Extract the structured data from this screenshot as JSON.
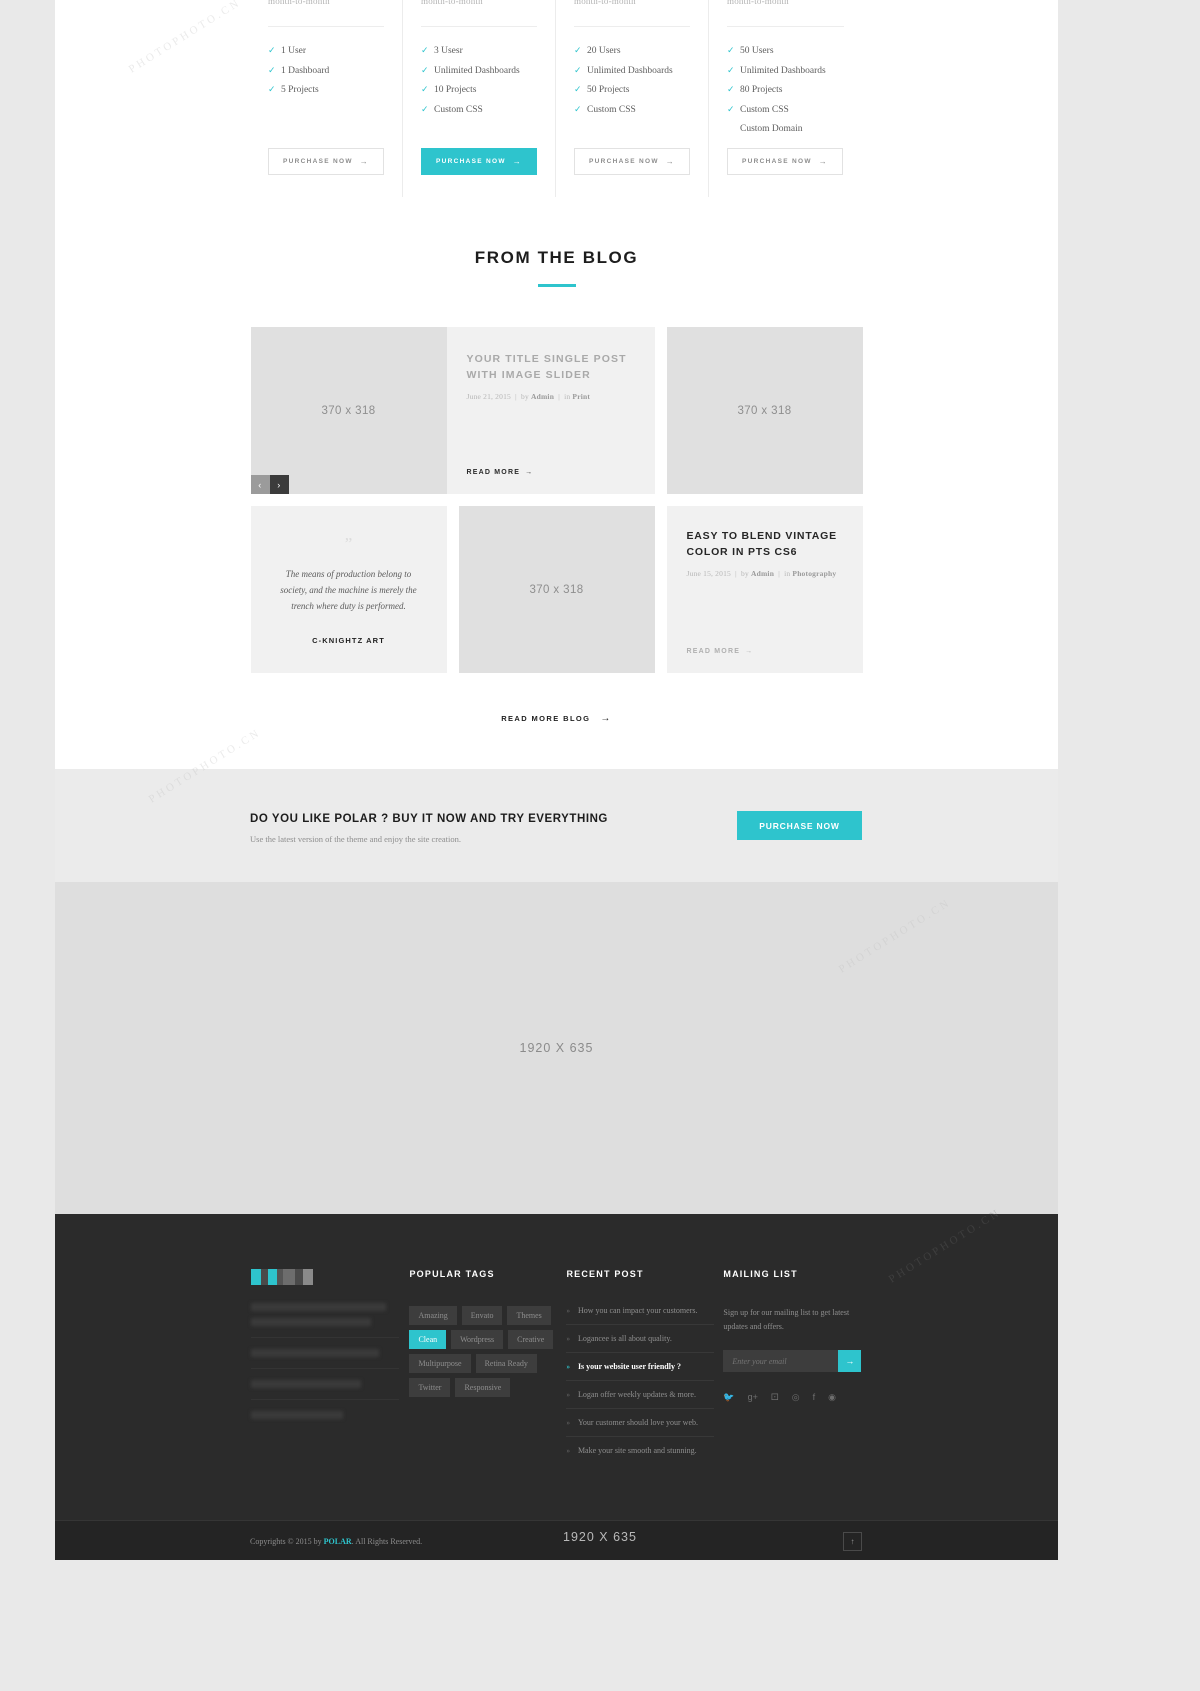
{
  "pricing": {
    "columns": [
      {
        "period": "month-to-month",
        "features": [
          "1 User",
          "1 Dashboard",
          "5 Projects"
        ],
        "button": "PURCHASE NOW",
        "featured": false
      },
      {
        "period": "month-to-month",
        "features": [
          "3 Usesr",
          "Unlimited Dashboards",
          "10 Projects",
          "Custom CSS"
        ],
        "button": "PURCHASE NOW",
        "featured": true
      },
      {
        "period": "month-to-month",
        "features": [
          "20 Users",
          "Unlimited Dashboards",
          "50 Projects",
          "Custom CSS"
        ],
        "button": "PURCHASE NOW",
        "featured": false
      },
      {
        "period": "month-to-month",
        "features": [
          "50 Users",
          "Unlimited Dashboards",
          "80 Projects",
          "Custom CSS",
          "Custom Domain"
        ],
        "button": "PURCHASE NOW",
        "featured": false
      }
    ]
  },
  "blog": {
    "section_title": "FROM THE BLOG",
    "slider_placeholder": "370 x 318",
    "slider_prev": "‹",
    "slider_next": "›",
    "post1": {
      "title": "YOUR TITLE SINGLE POST WITH IMAGE SLIDER",
      "date": "June 21, 2015",
      "by_label": "by",
      "author": "Admin",
      "in_label": "in",
      "category": "Print",
      "read_more": "READ MORE"
    },
    "quote": {
      "mark": "”",
      "text": "The means of production belong to society, and the machine is merely the trench where duty is performed.",
      "author": "C-KNIGHTZ ART"
    },
    "square_placeholder": "370 x 318",
    "right_placeholder": "370 x 318",
    "post2": {
      "title": "EASY TO BLEND VINTAGE COLOR IN PTS CS6",
      "date": "June 15, 2015",
      "by_label": "by",
      "author": "Admin",
      "in_label": "in",
      "category": "Photography",
      "read_more": "READ MORE"
    },
    "read_more_blog": "READ MORE BLOG"
  },
  "cta": {
    "title": "DO YOU LIKE POLAR ? BUY IT NOW AND TRY EVERYTHING",
    "subtitle": "Use the latest version of the theme and enjoy the site creation.",
    "button": "PURCHASE NOW"
  },
  "hero_placeholder": "1920 X 635",
  "footer": {
    "tags_heading": "POPULAR TAGS",
    "tags": [
      {
        "label": "Amazing",
        "active": false
      },
      {
        "label": "Envato",
        "active": false
      },
      {
        "label": "Themes",
        "active": false
      },
      {
        "label": "Clean",
        "active": true
      },
      {
        "label": "Wordpress",
        "active": false
      },
      {
        "label": "Creative",
        "active": false
      },
      {
        "label": "Multipurpose",
        "active": false
      },
      {
        "label": "Retina Ready",
        "active": false
      },
      {
        "label": "Twitter",
        "active": false
      },
      {
        "label": "Responsive",
        "active": false
      }
    ],
    "recent_heading": "RECENT POST",
    "recent_posts": [
      {
        "label": "How you can impact your customers.",
        "active": false
      },
      {
        "label": "Logancee is all about quality.",
        "active": false
      },
      {
        "label": "Is your website user friendly ?",
        "active": true
      },
      {
        "label": "Logan offer weekly updates & more.",
        "active": false
      },
      {
        "label": "Your customer should love your web.",
        "active": false
      },
      {
        "label": "Make your site smooth and stunning.",
        "active": false
      }
    ],
    "mailing_heading": "MAILING LIST",
    "mailing_text": "Sign up for our mailing list to get latest updates and offers.",
    "mail_placeholder": "Enter your email",
    "mail_submit": "→",
    "socials": [
      "twitter-icon",
      "google-plus-icon",
      "pinterest-icon",
      "rss-icon",
      "facebook-icon",
      "dribbble-icon"
    ],
    "copyright_prefix": "Copyrights © 2015 by ",
    "copyright_brand": "POLAR",
    "copyright_suffix": ". All Rights Reserved.",
    "to_top": "↑"
  },
  "outside_label": "1920 X 635",
  "colors": {
    "accent": "#2ec4cd",
    "dark": "#2b2b2b",
    "placeholder": "#e0e0e0"
  }
}
